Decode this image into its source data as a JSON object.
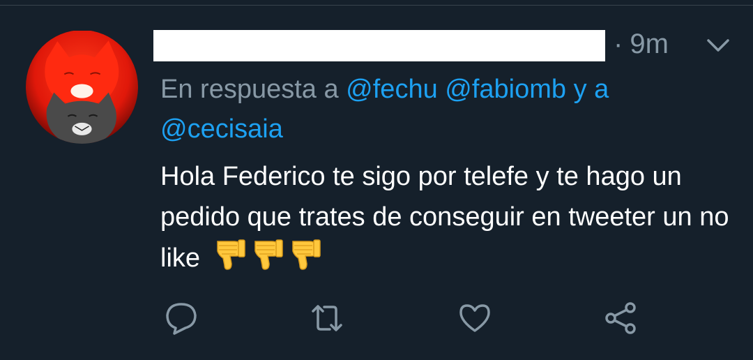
{
  "tweet": {
    "time_separator": "·",
    "time": "9m",
    "reply_prefix": "En respuesta a",
    "mentions": [
      "@fechu",
      "@fabiomb"
    ],
    "reply_and": "y a",
    "mention_last": "@cecisaia",
    "text": "Hola Federico te sigo por telefe y te hago un pedido que trates de conseguir en tweeter un no like",
    "emojis": [
      "thumbs-down-emoji",
      "thumbs-down-emoji",
      "thumbs-down-emoji"
    ]
  },
  "actions": {
    "icons": [
      "reply-icon",
      "retweet-icon",
      "like-icon",
      "share-icon"
    ]
  },
  "colors": {
    "background": "#15202b",
    "secondary_text": "#8899a6",
    "link": "#1da1f2",
    "text": "#ffffff",
    "emoji": "#ffc83d"
  }
}
